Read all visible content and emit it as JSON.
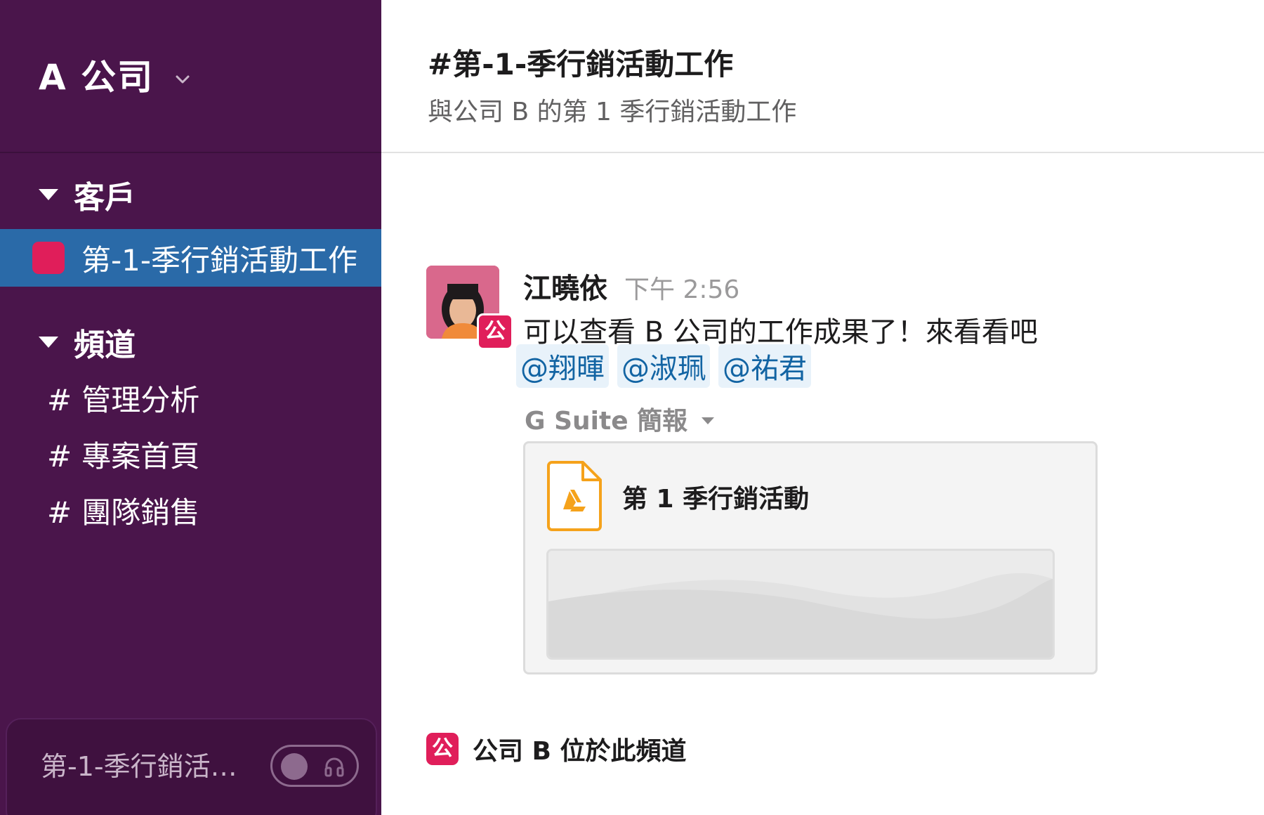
{
  "workspace": {
    "name": "A 公司",
    "chevron_icon": "chevron-down-icon"
  },
  "sidebar": {
    "sections": [
      {
        "label": "客戶",
        "items": [
          {
            "label": "第-1-季行銷活動工作",
            "active": true,
            "color": "#e01e5a"
          }
        ]
      },
      {
        "label": "頻道",
        "items": [
          {
            "prefix": "#",
            "label": "管理分析"
          },
          {
            "prefix": "#",
            "label": "專案首頁"
          },
          {
            "prefix": "#",
            "label": "團隊銷售"
          }
        ]
      }
    ],
    "call_bar": {
      "label": "第-1-季行銷活…",
      "toggle_icon": "headphones-icon"
    }
  },
  "channel": {
    "title": "#第-1-季行銷活動工作",
    "description": "與公司 B 的第 1 季行銷活動工作"
  },
  "message": {
    "author": "江曉依",
    "time": "下午 2:56",
    "org_badge": "公",
    "text": "可以查看 B 公司的工作成果了！來看看吧",
    "mentions": [
      "@翔暉",
      "@淑珮",
      "@祐君"
    ],
    "app_label": "G Suite 簡報",
    "attachment": {
      "title": "第 1 季行銷活動",
      "icon": "google-slides-icon"
    }
  },
  "org_note": {
    "icon": "公",
    "text": "公司 B 位於此頻道"
  },
  "colors": {
    "sidebar_bg": "#4a154b",
    "active_bg": "#2a6aa8",
    "accent_pink": "#e01e5a",
    "mention_blue": "#1264a3",
    "slides_orange": "#f5a21b"
  }
}
